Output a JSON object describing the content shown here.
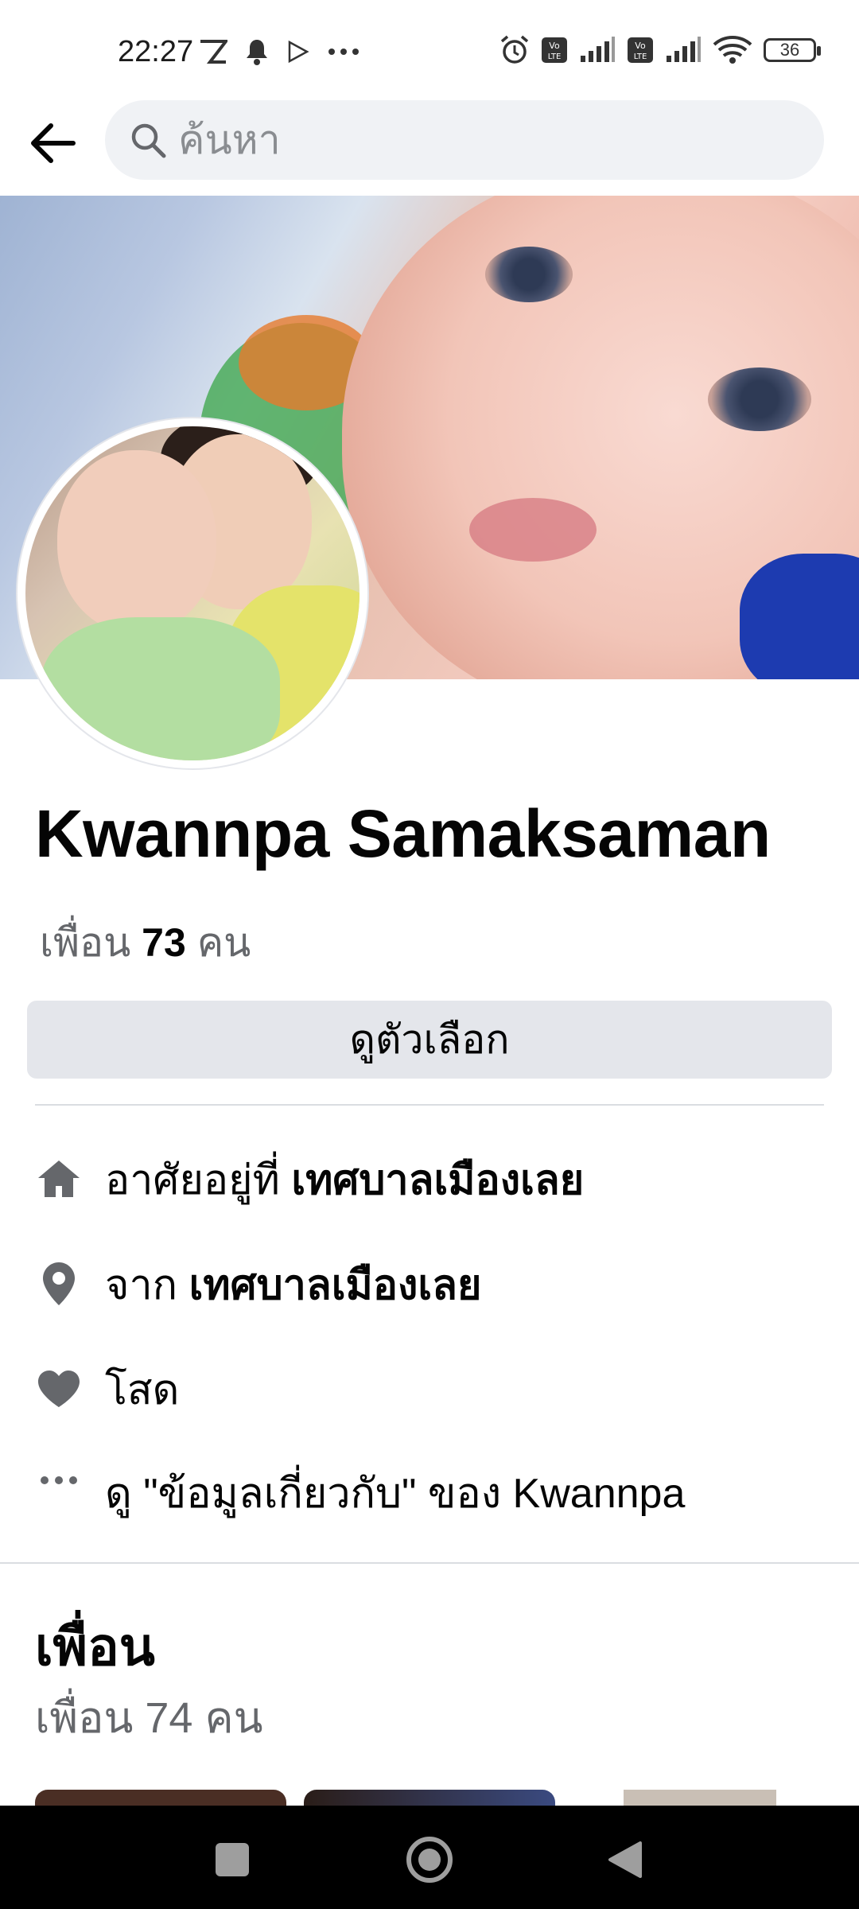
{
  "status_bar": {
    "time": "22:27",
    "battery": "36",
    "icons": [
      "nfc-icon",
      "bell-icon",
      "play-icon",
      "more-dots-icon",
      "alarm-icon",
      "volte-icon",
      "signal-icon",
      "wifi-icon",
      "battery-icon"
    ]
  },
  "search": {
    "placeholder": "ค้นหา"
  },
  "profile": {
    "name": "Kwannpa Samaksaman",
    "friends_prefix": "เพื่อน",
    "friends_count": "73",
    "friends_suffix": "คน",
    "options_button": "ดูตัวเลือก"
  },
  "info": {
    "lives_prefix": "อาศัยอยู่ที่",
    "lives_place": "เทศบาลเมืองเลย",
    "from_prefix": "จาก",
    "from_place": "เทศบาลเมืองเลย",
    "relationship": "โสด",
    "about_link": "ดู \"ข้อมูลเกี่ยวกับ\" ของ Kwannpa"
  },
  "friends_section": {
    "title": "เพื่อน",
    "count_text": "เพื่อน 74 คน"
  },
  "colors": {
    "accent_bg": "#e4e6eb",
    "secondary_text": "#65676b",
    "icon_gray": "#65676b"
  }
}
